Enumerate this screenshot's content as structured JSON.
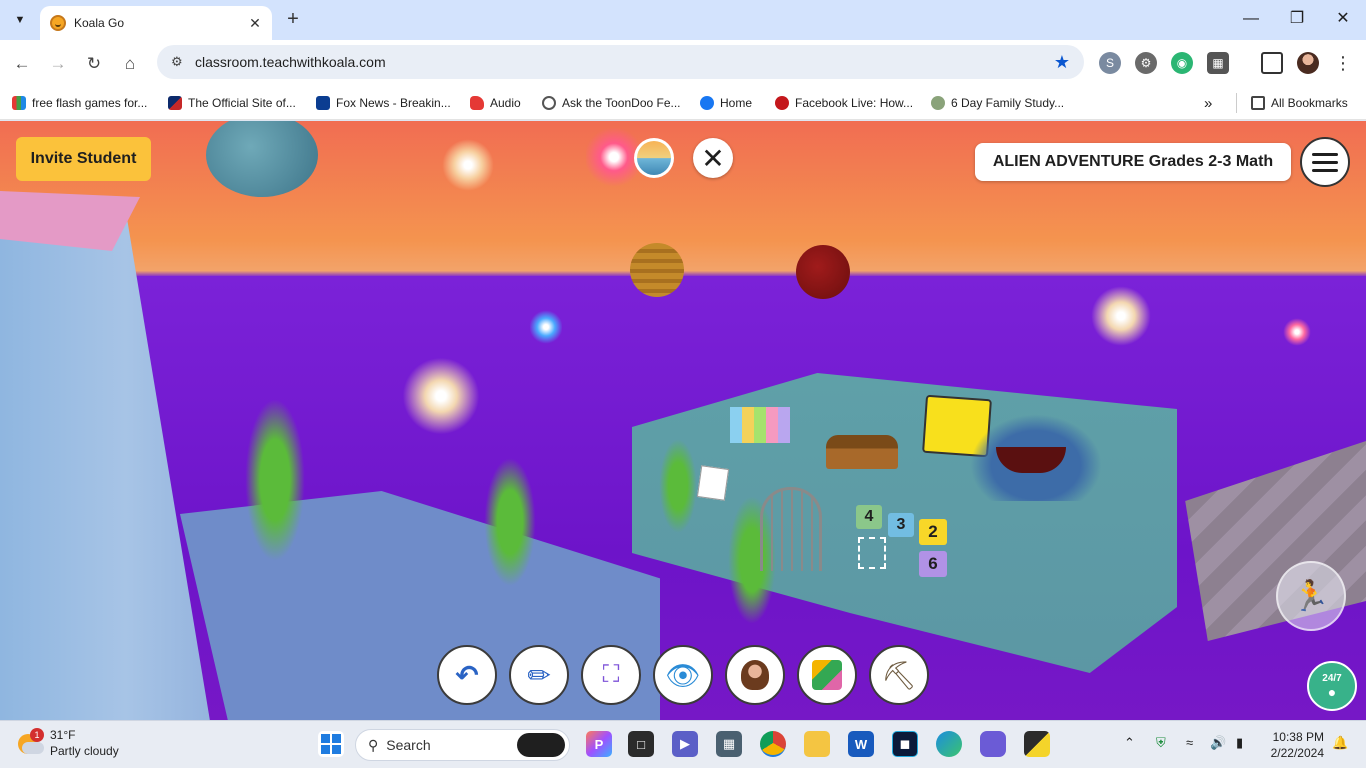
{
  "browser": {
    "tab": {
      "title": "Koala Go"
    },
    "omnibox": {
      "url": "classroom.teachwithkoala.com"
    },
    "bookmarks": [
      {
        "label": "free flash games for...",
        "icon": "pixel-game-icon",
        "color": "#e65100"
      },
      {
        "label": "The Official Site of...",
        "icon": "mlb-icon",
        "color": "#0d2a6b"
      },
      {
        "label": "Fox News - Breakin...",
        "icon": "fox-news-icon",
        "color": "#0b3d91"
      },
      {
        "label": "Audio",
        "icon": "audio-icon",
        "color": "#e53935"
      },
      {
        "label": "Ask the ToonDoo Fe...",
        "icon": "globe-icon",
        "color": "#555555"
      },
      {
        "label": "Home",
        "icon": "facebook-icon",
        "color": "#1877f2"
      },
      {
        "label": "Facebook Live: How...",
        "icon": "youtube-icon",
        "color": "#c4171c"
      },
      {
        "label": "6 Day Family Study...",
        "icon": "study-icon",
        "color": "#8aa37a"
      }
    ],
    "all_bookmarks": "All Bookmarks"
  },
  "game": {
    "invite_label": "Invite Student",
    "world_title": "ALIEN ADVENTURE Grades 2-3 Math",
    "number_tiles": [
      "4",
      "3",
      "2",
      "6"
    ],
    "help_label": "24/7",
    "tools": [
      {
        "name": "undo-tool-button",
        "icon": "undo-icon"
      },
      {
        "name": "pencil-tool-button",
        "icon": "pencil-icon"
      },
      {
        "name": "focus-tool-button",
        "icon": "focus-icon"
      },
      {
        "name": "view-tool-button",
        "icon": "eye-icon"
      },
      {
        "name": "teacher-tool-button",
        "icon": "teacher-avatar-icon"
      },
      {
        "name": "blocks-tool-button",
        "icon": "blocks-icon"
      },
      {
        "name": "shovel-tool-button",
        "icon": "shovel-icon"
      }
    ]
  },
  "taskbar": {
    "weather": {
      "temp": "31°F",
      "desc": "Partly cloudy",
      "badge": "1"
    },
    "search_placeholder": "Search",
    "time": "10:38 PM",
    "date": "2/22/2024"
  }
}
